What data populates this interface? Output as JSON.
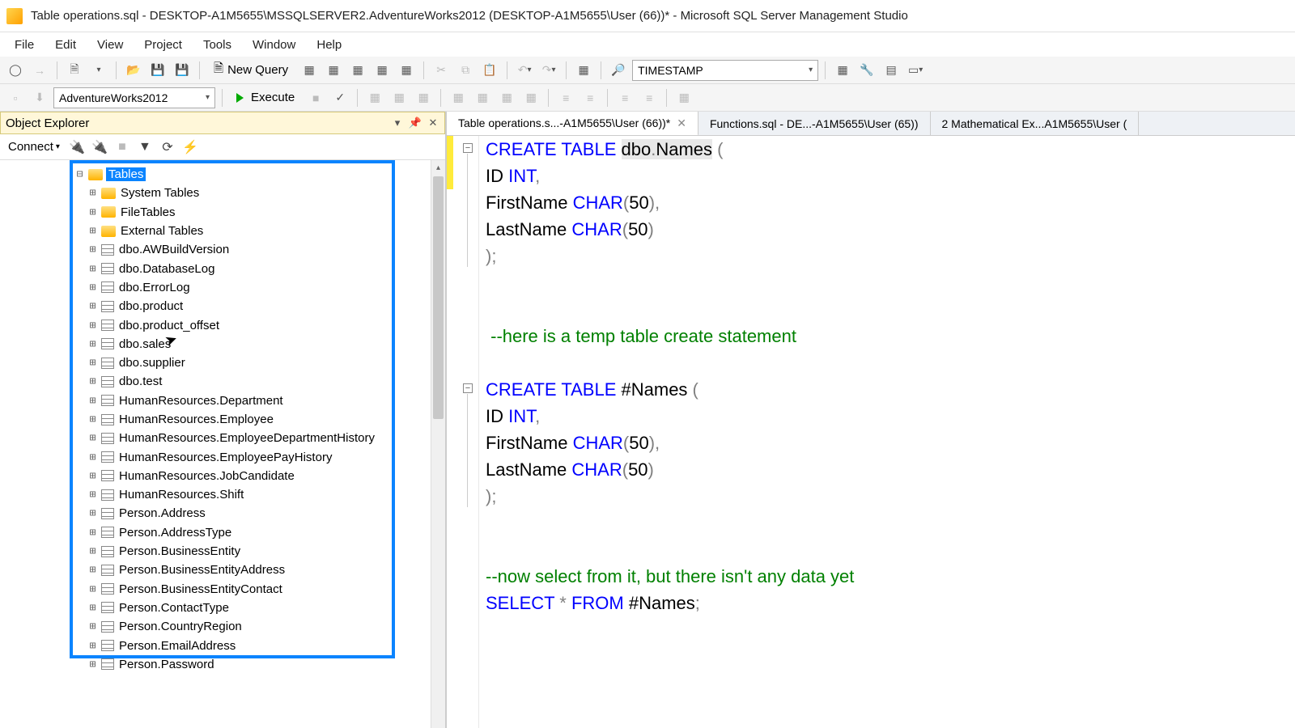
{
  "titlebar": {
    "text": "Table operations.sql - DESKTOP-A1M5655\\MSSQLSERVER2.AdventureWorks2012 (DESKTOP-A1M5655\\User (66))* - Microsoft SQL Server Management Studio"
  },
  "menu": [
    "File",
    "Edit",
    "View",
    "Project",
    "Tools",
    "Window",
    "Help"
  ],
  "toolbar1": {
    "new_query": "New Query",
    "search_combo": "TIMESTAMP"
  },
  "toolbar2": {
    "db_combo": "AdventureWorks2012",
    "execute": "Execute"
  },
  "object_explorer": {
    "title": "Object Explorer",
    "connect": "Connect",
    "root": "Tables",
    "folders": [
      "System Tables",
      "FileTables",
      "External Tables"
    ],
    "tables": [
      "dbo.AWBuildVersion",
      "dbo.DatabaseLog",
      "dbo.ErrorLog",
      "dbo.product",
      "dbo.product_offset",
      "dbo.sales",
      "dbo.supplier",
      "dbo.test",
      "HumanResources.Department",
      "HumanResources.Employee",
      "HumanResources.EmployeeDepartmentHistory",
      "HumanResources.EmployeePayHistory",
      "HumanResources.JobCandidate",
      "HumanResources.Shift",
      "Person.Address",
      "Person.AddressType",
      "Person.BusinessEntity",
      "Person.BusinessEntityAddress",
      "Person.BusinessEntityContact",
      "Person.ContactType",
      "Person.CountryRegion",
      "Person.EmailAddress",
      "Person.Password"
    ]
  },
  "tabs": [
    {
      "label": "Table operations.s...-A1M5655\\User (66))*",
      "active": true,
      "closeable": true
    },
    {
      "label": "Functions.sql - DE...-A1M5655\\User (65))",
      "active": false,
      "closeable": false
    },
    {
      "label": "2 Mathematical Ex...A1M5655\\User (",
      "active": false,
      "closeable": false
    }
  ],
  "code": {
    "l1_a": "CREATE",
    "l1_b": "TABLE",
    "l1_c": "dbo",
    "l1_d": "Names",
    "l1_e": " (",
    "l2_a": "ID ",
    "l2_b": "INT",
    "l2_c": ",",
    "l3_a": "FirstName ",
    "l3_b": "CHAR",
    "l3_c": "(",
    "l3_d": "50",
    "l3_e": "),",
    "l4_a": "LastName ",
    "l4_b": "CHAR",
    "l4_c": "(",
    "l4_d": "50",
    "l4_e": ")",
    "l5": ");",
    "l7": " --here is a temp table create statement",
    "l9_a": "CREATE",
    "l9_b": "TABLE",
    "l9_c": " #Names ",
    "l9_d": "(",
    "l10_a": "ID ",
    "l10_b": "INT",
    "l10_c": ",",
    "l11_a": "FirstName ",
    "l11_b": "CHAR",
    "l11_c": "(",
    "l11_d": "50",
    "l11_e": "),",
    "l12_a": "LastName ",
    "l12_b": "CHAR",
    "l12_c": "(",
    "l12_d": "50",
    "l12_e": ")",
    "l13": ");",
    "l15": "--now select from it, but there isn't any data yet",
    "l16_a": "SELECT",
    "l16_b": " * ",
    "l16_c": "FROM",
    "l16_d": " #Names",
    "l16_e": ";"
  }
}
